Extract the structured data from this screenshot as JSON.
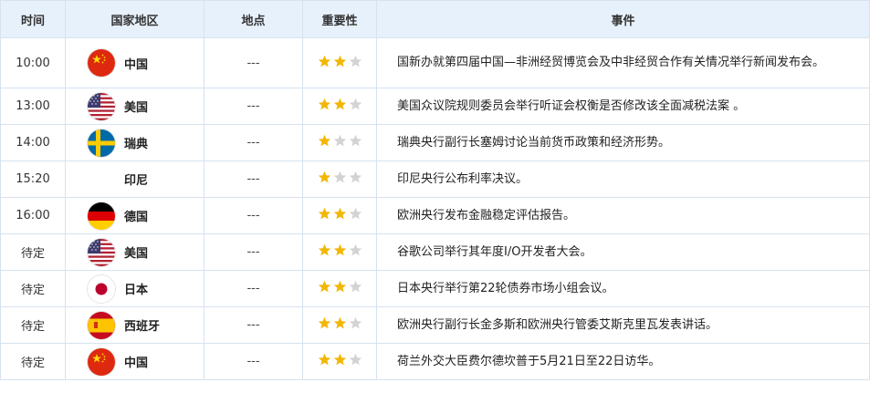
{
  "header": {
    "time": "时间",
    "region": "国家地区",
    "location": "地点",
    "importance": "重要性",
    "event": "事件"
  },
  "colors": {
    "star_on": "#f2b705",
    "star_off": "#d3d3d3",
    "header_bg": "#e7f1fc",
    "border": "#d6e2ef"
  },
  "rows": [
    {
      "time": "10:00",
      "flag": "china-flag-icon",
      "region": "中国",
      "location": "---",
      "stars": 2,
      "event": "国新办就第四届中国—非洲经贸博览会及中非经贸合作有关情况举行新闻发布会。"
    },
    {
      "time": "13:00",
      "flag": "usa-flag-icon",
      "region": "美国",
      "location": "---",
      "stars": 2,
      "event": "美国众议院规则委员会举行听证会权衡是否修改该全面减税法案 。"
    },
    {
      "time": "14:00",
      "flag": "sweden-flag-icon",
      "region": "瑞典",
      "location": "---",
      "stars": 1,
      "event": "瑞典央行副行长塞姆讨论当前货币政策和经济形势。"
    },
    {
      "time": "15:20",
      "flag": "",
      "region": "印尼",
      "location": "---",
      "stars": 1,
      "event": "印尼央行公布利率决议。"
    },
    {
      "time": "16:00",
      "flag": "germany-flag-icon",
      "region": "德国",
      "location": "---",
      "stars": 2,
      "event": "欧洲央行发布金融稳定评估报告。"
    },
    {
      "time": "待定",
      "flag": "usa-flag-icon",
      "region": "美国",
      "location": "---",
      "stars": 2,
      "event": "谷歌公司举行其年度I/O开发者大会。"
    },
    {
      "time": "待定",
      "flag": "japan-flag-icon",
      "region": "日本",
      "location": "---",
      "stars": 2,
      "event": "日本央行举行第22轮债券市场小组会议。"
    },
    {
      "time": "待定",
      "flag": "spain-flag-icon",
      "region": "西班牙",
      "location": "---",
      "stars": 2,
      "event": "欧洲央行副行长金多斯和欧洲央行管委艾斯克里瓦发表讲话。"
    },
    {
      "time": "待定",
      "flag": "china-flag-icon",
      "region": "中国",
      "location": "---",
      "stars": 2,
      "event": "荷兰外交大臣费尔德坎普于5月21日至22日访华。"
    }
  ]
}
